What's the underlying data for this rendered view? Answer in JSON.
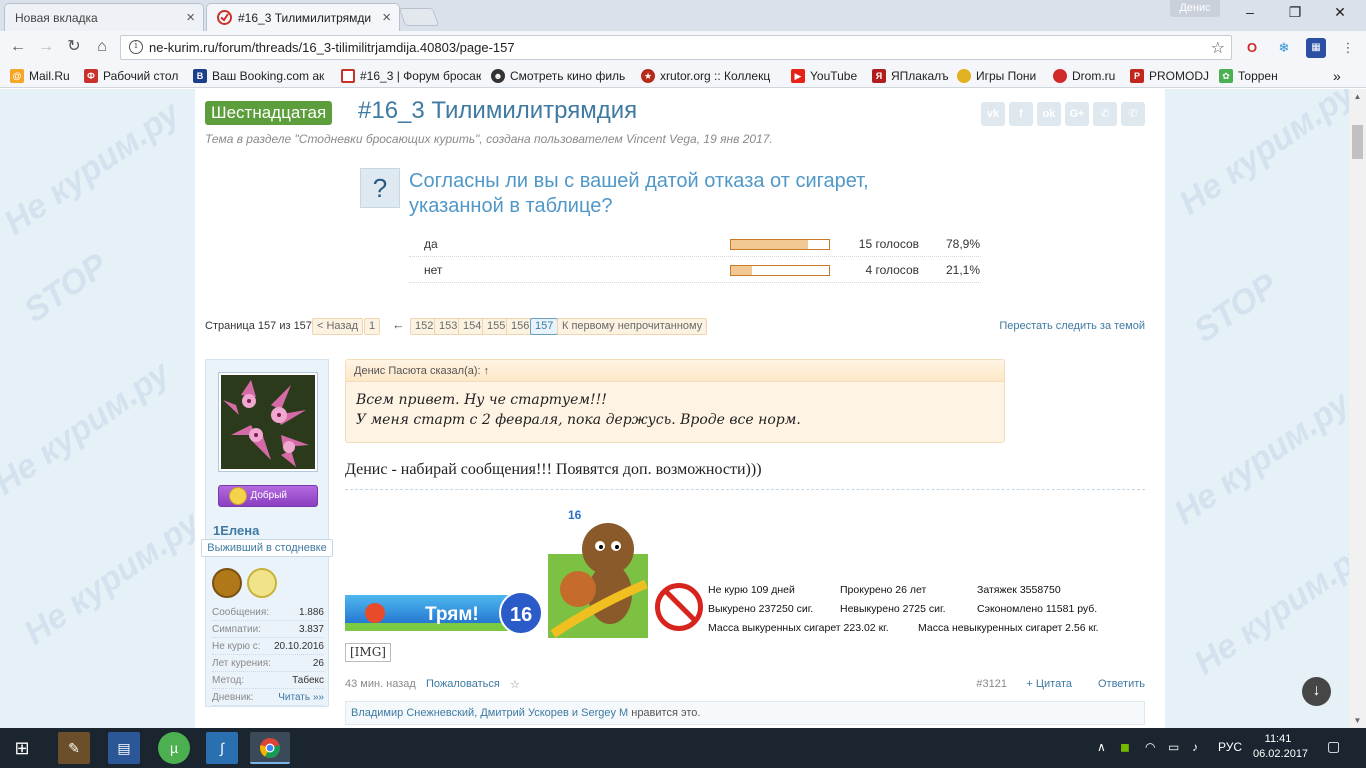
{
  "browser": {
    "tabs": [
      {
        "title": "Новая вкладка",
        "active": false
      },
      {
        "title": "#16_3 Тилимилитрямди",
        "active": true
      }
    ],
    "profile_name": "Денис",
    "url": "ne-kurim.ru/forum/threads/16_3-tilimilitrjamdija.40803/page-157",
    "bookmarks": [
      {
        "label": "Mail.Ru",
        "color": "#f5a623"
      },
      {
        "label": "Рабочий стол",
        "color": "#c8322a"
      },
      {
        "label": "Ваш Booking.com ак",
        "color": "#1b3f8b"
      },
      {
        "label": "#16_3 | Форум бросаю",
        "color": "#c8322a"
      },
      {
        "label": "Смотреть кино филь",
        "color": "#333333"
      },
      {
        "label": "xrutor.org :: Коллекц",
        "color": "#b52a1a"
      },
      {
        "label": "YouTube",
        "color": "#e62117"
      },
      {
        "label": "ЯПлакалъ",
        "color": "#b01d1d"
      },
      {
        "label": "Игры Пони",
        "color": "#e0b21f"
      },
      {
        "label": "Drom.ru",
        "color": "#d02a2a"
      },
      {
        "label": "PROMODJ",
        "color": "#c2261c"
      },
      {
        "label": "Торрен",
        "color": "#4caf50"
      }
    ]
  },
  "thread": {
    "prefix": "Шестнадцатая",
    "title": "#16_3 Тилимилитрямдия",
    "description": "Тема в разделе \"Стодневки бросающих курить\", создана пользователем Vincent Vega, 19 янв 2017."
  },
  "poll": {
    "question": "Согласны ли вы с вашей датой отказа от сигарет, указанной в таблице?",
    "icon": "?",
    "options": [
      {
        "label": "да",
        "votes": "15 голосов",
        "percent": "78,9%",
        "fraction": 0.789
      },
      {
        "label": "нет",
        "votes": "4 голосов",
        "percent": "21,1%",
        "fraction": 0.211
      }
    ]
  },
  "pagenav": {
    "label": "Страница 157 из 157",
    "prev": "< Назад",
    "first": "1",
    "ellipsis": "←",
    "pages": [
      "152",
      "153",
      "154",
      "155",
      "156",
      "157"
    ],
    "current": "157",
    "first_unread": "К первому непрочитанному",
    "unwatch": "Перестать следить за темой"
  },
  "post": {
    "user": {
      "name": "1Елена",
      "title": "Выживший в стодневке",
      "mood": "Добрый",
      "stats": [
        {
          "label": "Сообщения:",
          "value": "1.886"
        },
        {
          "label": "Симпатии:",
          "value": "3.837"
        },
        {
          "label": "Не курю с:",
          "value": "20.10.2016"
        },
        {
          "label": "Лет курения:",
          "value": "26"
        },
        {
          "label": "Метод:",
          "value": "Табекс"
        },
        {
          "label": "Дневник:",
          "value": "Читать »»"
        }
      ]
    },
    "quote": {
      "header": "Денис Пасюта сказал(а): ↑",
      "line1": "Всем привет. Ну че стартуем!!!",
      "line2": "У меня старт с 2 февраля, пока держусь. Вроде все норм."
    },
    "message": "Денис - набирай сообщения!!! Появятся доп. возможности)))",
    "signature": {
      "tram_text": "Трям!",
      "tram_number": "16",
      "bear_badge": "16",
      "broken_img": "[IMG]",
      "stats": {
        "no_smoke_days": "Не курю 109 дней",
        "smoked_years": "Прокурено 26 лет",
        "puffs": "Затяжек 3558750",
        "smoked_cigs": "Выкурено 237250 сиг.",
        "not_smoked_cigs": "Невыкурено 2725 сиг.",
        "saved": "Сэкономлено 11581 руб.",
        "mass_smoked": "Масса выкуренных сигарет 223.02 кг.",
        "mass_not_smoked": "Масса невыкуренных сигарет 2.56 кг."
      }
    },
    "time": "43 мин. назад",
    "report": "Пожаловаться",
    "star": "☆",
    "number": "#3121",
    "quote_btn": "+ Цитата",
    "reply": "Ответить",
    "likes_names": "Владимир Снежневский, Дмитрий Ускорев и Sergey M",
    "likes_suffix": " нравится это."
  },
  "watermark": {
    "text1": "Не курим.ру",
    "text2": "STOP"
  },
  "taskbar": {
    "lang": "РУС",
    "time": "11:41",
    "date": "06.02.2017"
  },
  "colors": {
    "accent": "#3e7aa2",
    "prefix": "#5c9e3b",
    "poll_fill": "#f3c993"
  }
}
